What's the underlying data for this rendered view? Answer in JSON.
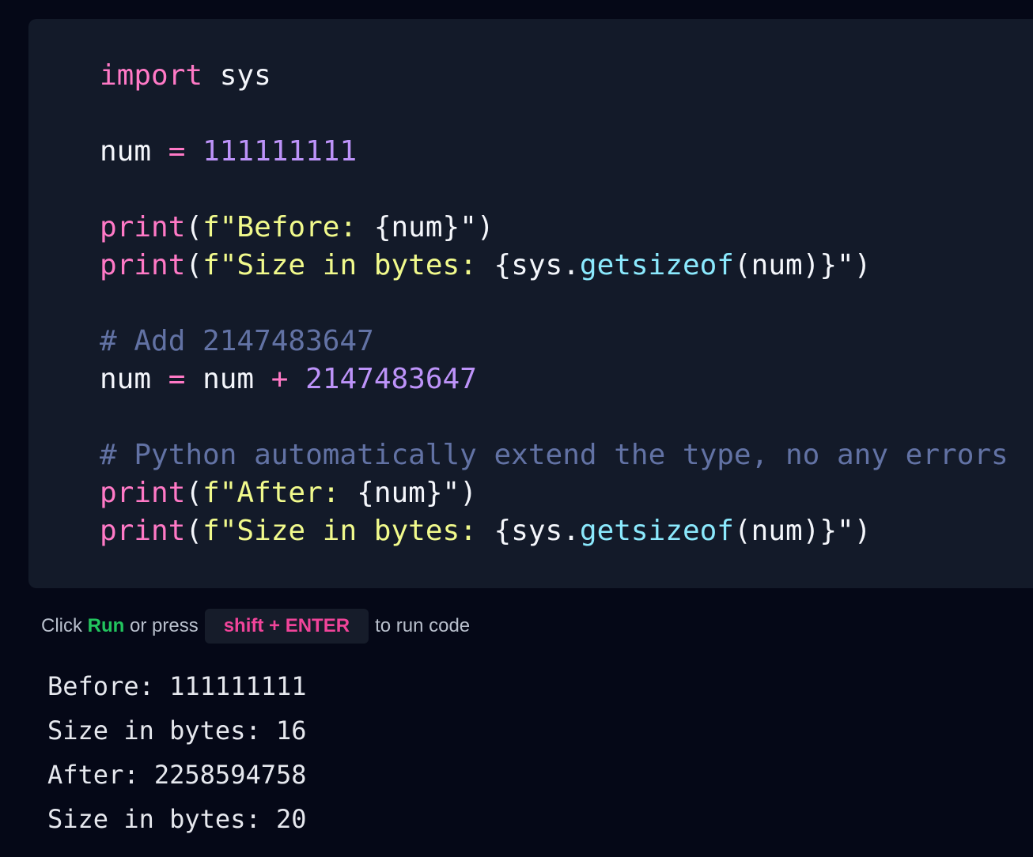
{
  "code": {
    "l1": {
      "kw": "import",
      "rest": " sys"
    },
    "l3": {
      "var": "num",
      "eq": " = ",
      "val": "111111111"
    },
    "l5": {
      "fn": "print",
      "open": "(",
      "str": "f\"Before: ",
      "brace": "{num}",
      "close_str": "\")"
    },
    "l6": {
      "fn": "print",
      "open": "(",
      "str": "f\"Size in bytes: ",
      "brace_open": "{sys.",
      "meth": "getsizeof",
      "args": "(num)}",
      "close_str": "\")"
    },
    "l8": {
      "comment": "# Add 2147483647"
    },
    "l9": {
      "var": "num",
      "eq": " = ",
      "var2": "num ",
      "plus": "+",
      "val": " 2147483647"
    },
    "l11": {
      "comment": "# Python automatically extend the type, no any errors"
    },
    "l12": {
      "fn": "print",
      "open": "(",
      "str": "f\"After: ",
      "brace": "{num}",
      "close_str": "\")"
    },
    "l13": {
      "fn": "print",
      "open": "(",
      "str": "f\"Size in bytes: ",
      "brace_open": "{sys.",
      "meth": "getsizeof",
      "args": "(num)}",
      "close_str": "\")"
    }
  },
  "hint": {
    "pre": "Click ",
    "run": "Run",
    "mid": " or press",
    "shortcut": "shift + ENTER",
    "post": "to run code"
  },
  "output": [
    "Before: 111111111",
    "Size in bytes: 16",
    "After: 2258594758",
    "Size in bytes: 20"
  ],
  "colors": {
    "background": "#050817",
    "panel": "#131a29",
    "keyword": "#ff79c6",
    "number": "#bd93f9",
    "string": "#f1fa8c",
    "comment": "#6272a4",
    "method": "#8be9fd",
    "run_accent": "#22c55e",
    "shortcut_accent": "#f0449a"
  }
}
